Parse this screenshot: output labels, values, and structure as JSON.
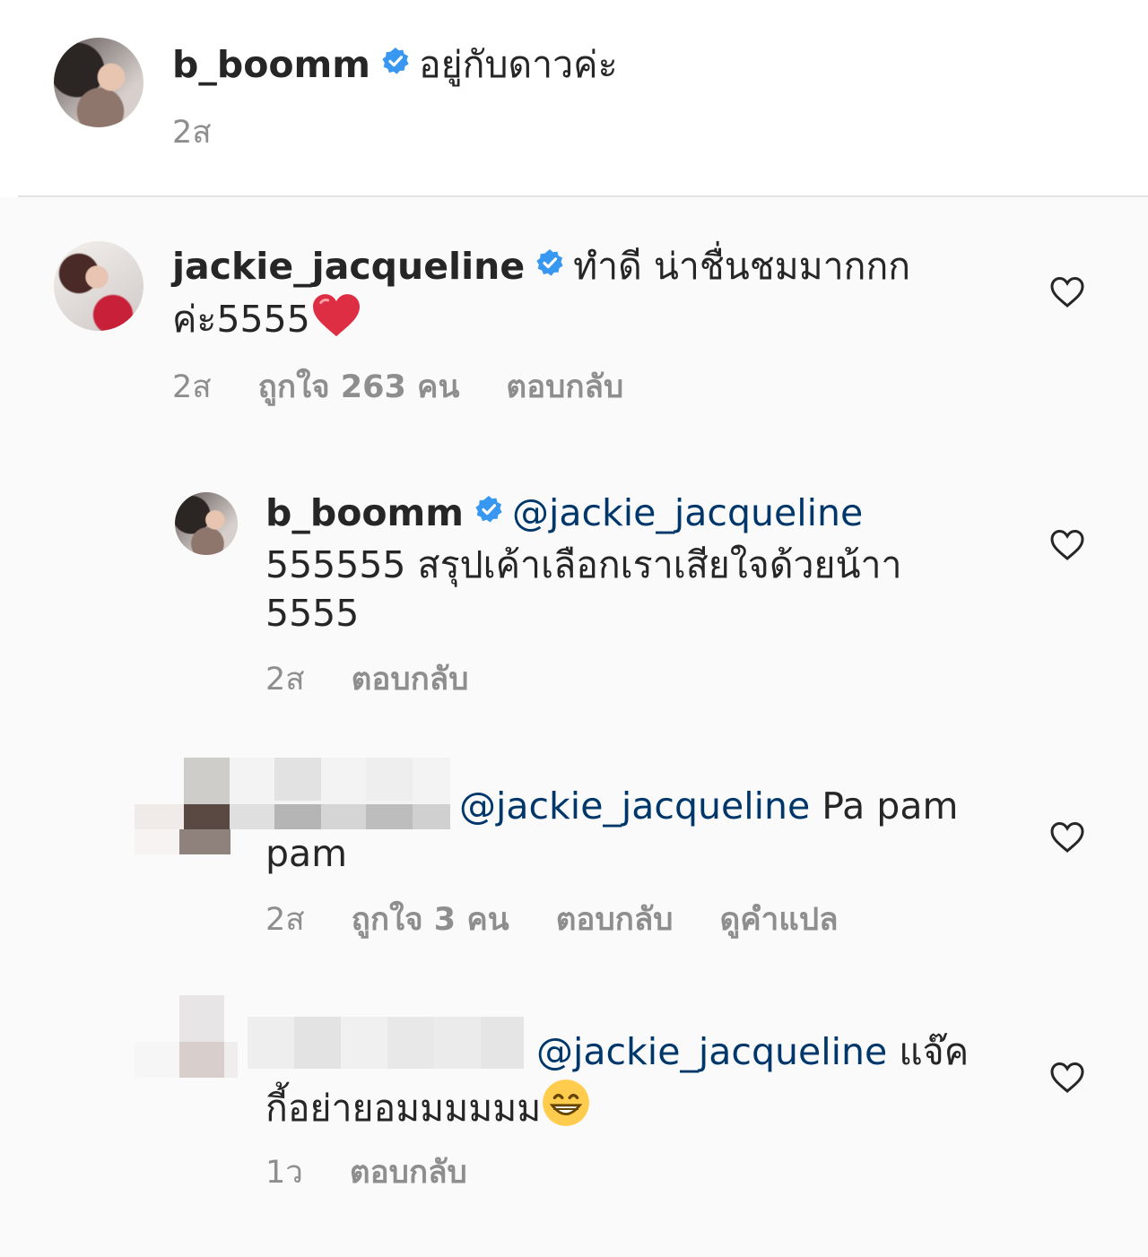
{
  "caption": {
    "username": "b_boomm",
    "text": "อยู่กับดาวค่ะ",
    "time": "2ส"
  },
  "comments": [
    {
      "username": "jackie_jacqueline",
      "text_line1": "ทำดี น่าชื่นชมมากกก",
      "text_line2": "ค่ะ5555",
      "emoji": "red-heart",
      "time": "2ส",
      "likes": "ถูกใจ 263 คน",
      "reply": "ตอบกลับ"
    },
    {
      "username": "b_boomm",
      "mention": "@jackie_jacqueline",
      "text_line1": "555555 สรุปเค้าเลือกเราเสียใจด้วยน้าา",
      "text_line2": "5555",
      "time": "2ส",
      "reply": "ตอบกลับ"
    },
    {
      "mention": "@jackie_jacqueline",
      "text_after": "Pa pam",
      "text_line2": "pam",
      "time": "2ส",
      "likes": "ถูกใจ 3 คน",
      "reply": "ตอบกลับ",
      "translate": "ดูคำแปล"
    },
    {
      "mention": "@jackie_jacqueline",
      "text_after": "แจ๊ค",
      "text_line2": "กี้อย่ายอมมมมมม",
      "emoji": "grinning-face",
      "time": "1ว",
      "reply": "ตอบกลับ"
    }
  ],
  "colors": {
    "verified_blue": "#3897f0",
    "mention": "#00376b",
    "meta_gray": "#8e8e8e"
  }
}
